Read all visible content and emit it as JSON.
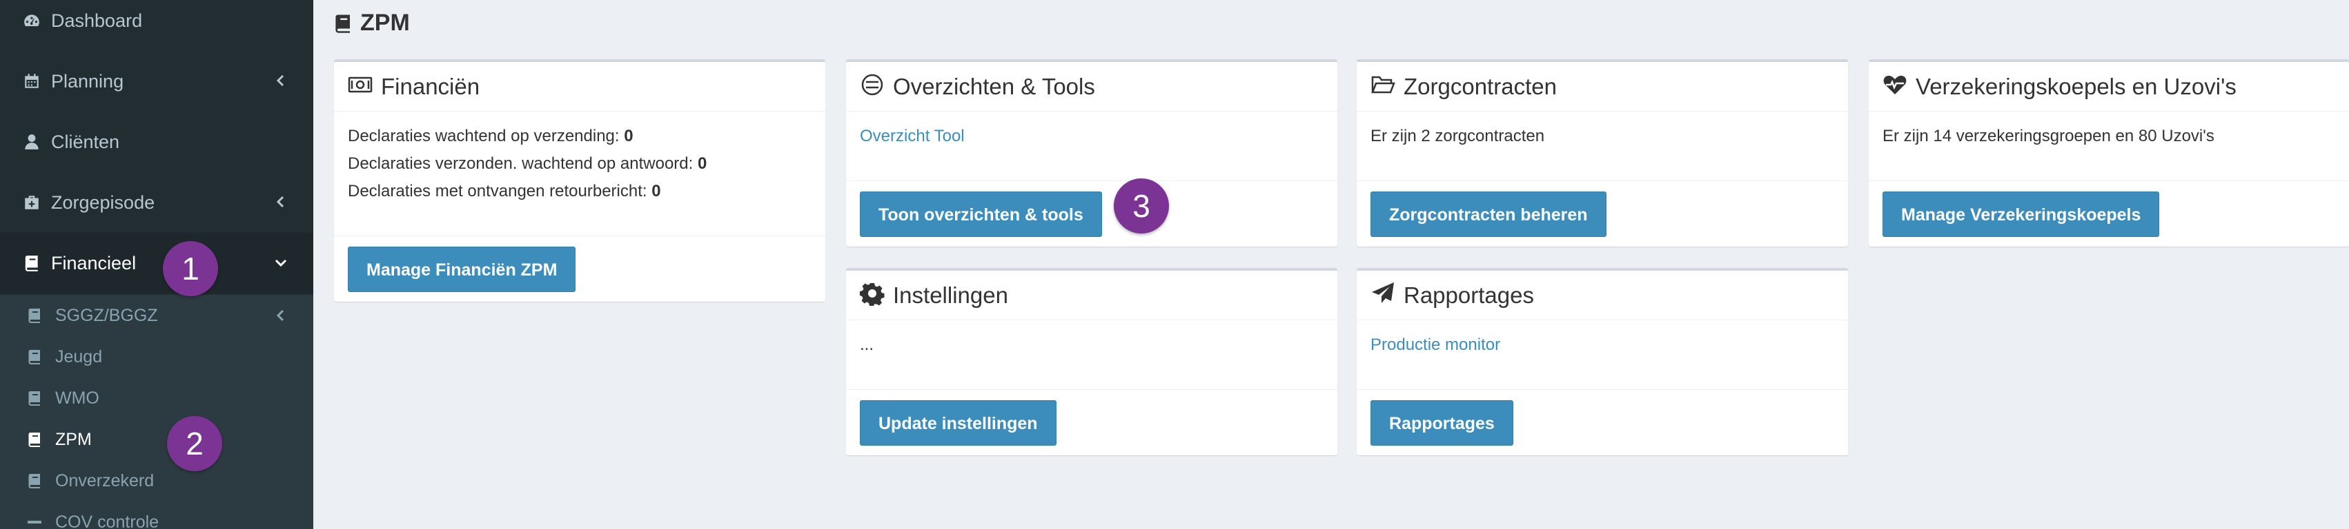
{
  "sidebar": {
    "items": [
      {
        "label": "Dashboard",
        "icon": "dashboard-icon"
      },
      {
        "label": "Planning",
        "icon": "calendar-icon"
      },
      {
        "label": "Cliënten",
        "icon": "user-icon"
      },
      {
        "label": "Zorgepisode",
        "icon": "medkit-icon"
      },
      {
        "label": "Financieel",
        "icon": "book-icon"
      }
    ],
    "sub_items": [
      {
        "label": "SGGZ/BGGZ",
        "icon": "book-icon"
      },
      {
        "label": "Jeugd",
        "icon": "book-icon"
      },
      {
        "label": "WMO",
        "icon": "book-icon"
      },
      {
        "label": "ZPM",
        "icon": "book-icon"
      },
      {
        "label": "Onverzekerd",
        "icon": "book-icon"
      },
      {
        "label": "COV controle",
        "icon": "minus-icon"
      }
    ]
  },
  "page": {
    "title": "ZPM"
  },
  "cards": {
    "financien": {
      "title": "Financiën",
      "icon": "money-icon",
      "lines": [
        {
          "label": "Declaraties wachtend op verzending:",
          "value": "0"
        },
        {
          "label": "Declaraties verzonden. wachtend op antwoord:",
          "value": "0"
        },
        {
          "label": "Declaraties met ontvangen retourbericht:",
          "value": "0"
        }
      ],
      "button": "Manage Financiën ZPM"
    },
    "overzichten": {
      "title": "Overzichten & Tools",
      "icon": "tools-icon",
      "link": "Overzicht Tool",
      "button": "Toon overzichten & tools"
    },
    "zorgcontracten": {
      "title": "Zorgcontracten",
      "icon": "folder-open-icon",
      "text": "Er zijn 2 zorgcontracten",
      "button": "Zorgcontracten beheren"
    },
    "verzekering": {
      "title": "Verzekeringskoepels en Uzovi's",
      "icon": "heartbeat-icon",
      "text": "Er zijn 14 verzekeringsgroepen en 80 Uzovi's",
      "button": "Manage Verzekeringskoepels"
    },
    "instellingen": {
      "title": "Instellingen",
      "icon": "gear-icon",
      "text": "...",
      "button": "Update instellingen"
    },
    "rapportages": {
      "title": "Rapportages",
      "icon": "paper-plane-icon",
      "link": "Productie monitor",
      "button": "Rapportages"
    }
  },
  "badges": [
    "1",
    "2",
    "3"
  ],
  "colors": {
    "accent": "#3c8dbc",
    "sidebar": "#222d32",
    "badge": "#7b3494"
  }
}
